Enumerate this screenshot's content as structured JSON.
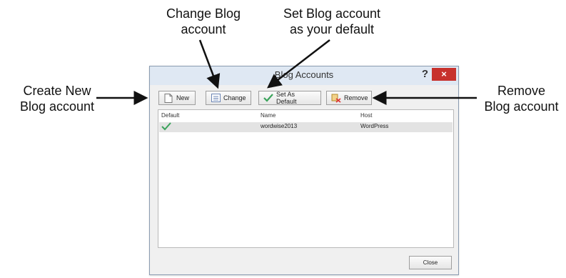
{
  "callouts": {
    "change": "Change Blog\naccount",
    "set_default": "Set Blog account\nas your default",
    "create_new": "Create New\nBlog account",
    "remove": "Remove\nBlog account"
  },
  "dialog": {
    "title": "Blog Accounts",
    "help_label": "?",
    "close_glyph": "×",
    "toolbar": {
      "new_label": "New",
      "change_label": "Change",
      "set_default_label": "Set As Default",
      "remove_label": "Remove"
    },
    "list": {
      "columns": [
        "Default",
        "Name",
        "Host"
      ],
      "rows": [
        {
          "default_icon": "checkmark-icon",
          "name": "wordwise2013",
          "host": "WordPress"
        }
      ]
    },
    "close_button": "Close"
  },
  "colors": {
    "titlebar": "#dfe8f3",
    "close_button": "#c7312c",
    "checkmark": "#3aa35b",
    "selected_row": "#e3e3e3"
  }
}
